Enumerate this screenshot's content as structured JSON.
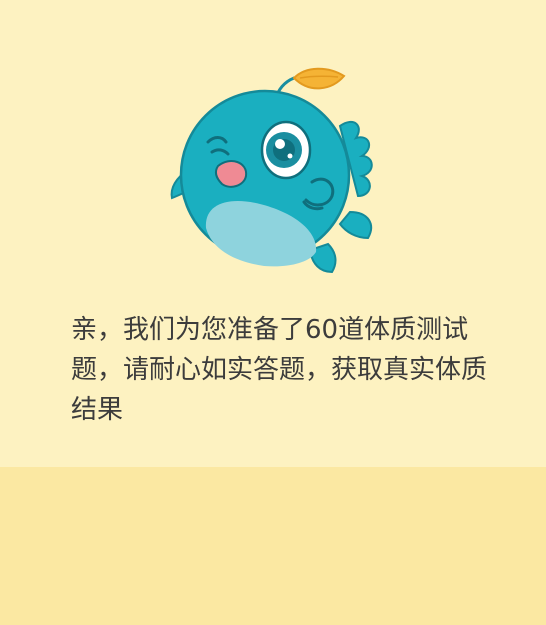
{
  "intro": {
    "message": "亲，我们为您准备了60道体质测试题，请耐心如实答题，获取真实体质结果"
  },
  "colors": {
    "top_background": "#fdf2c1",
    "bottom_background": "#fbe8a2",
    "mascot_body": "#1aafc0",
    "mascot_belly": "#8ed3dd",
    "mascot_leaf": "#f5b335",
    "mascot_mouth": "#ef8a94",
    "text": "#3c3c3c"
  },
  "mascot": {
    "icon": "fish-mascot-icon"
  }
}
